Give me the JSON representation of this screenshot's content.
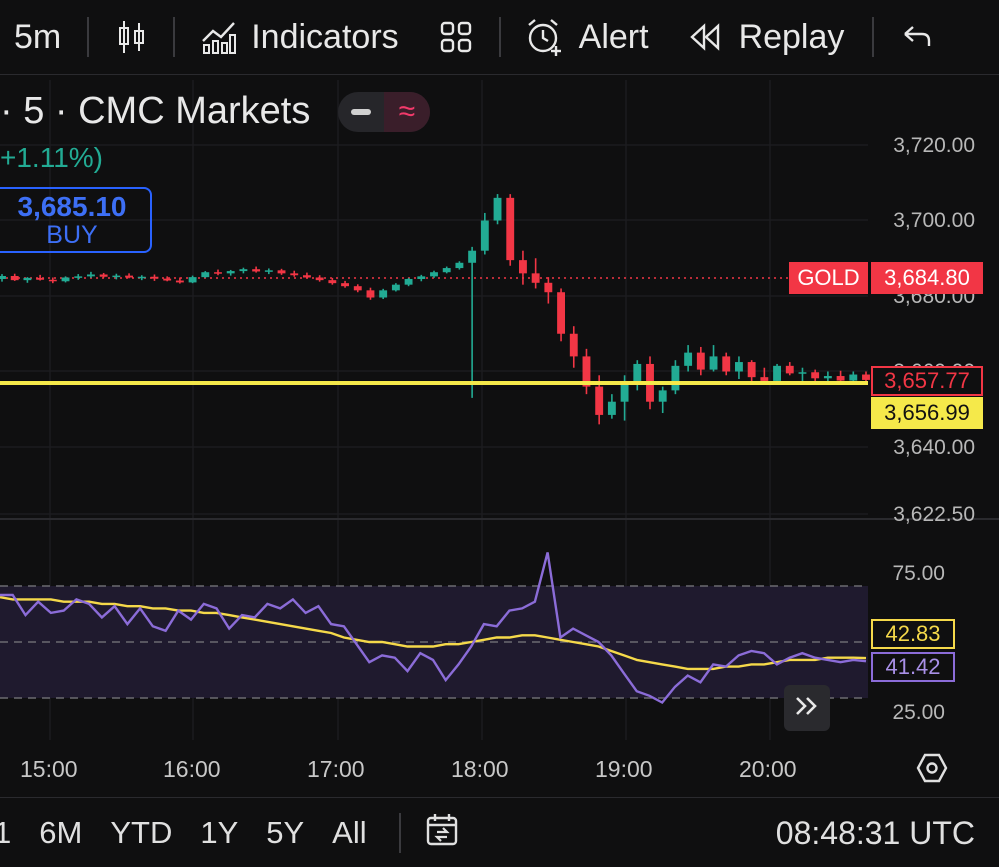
{
  "toolbar": {
    "interval": "5m",
    "indicators_label": "Indicators",
    "alert_label": "Alert",
    "replay_label": "Replay",
    "icons": [
      "candles-icon",
      "indicators-icon",
      "layout-icon",
      "alert-icon",
      "replay-icon",
      "undo-icon"
    ]
  },
  "legend": {
    "title": "· 5 · CMC Markets",
    "change": "+1.11%)",
    "buy_price": "3,685.10",
    "buy_label": "BUY"
  },
  "price_axis": [
    "3,720.00",
    "3,700.00",
    "3,680.00",
    "3,660.00",
    "3,640.00",
    "3,622.50"
  ],
  "tags": {
    "symbol": "GOLD",
    "symbol_price": "3,684.80",
    "last_price": "3,657.77",
    "line_price": "3,656.99",
    "rsi_ma": "42.83",
    "rsi": "41.42"
  },
  "rsi_axis": [
    "75.00",
    "25.00"
  ],
  "time_axis": [
    "15:00",
    "16:00",
    "17:00",
    "18:00",
    "19:00",
    "20:00"
  ],
  "ranges": [
    "1",
    "6M",
    "YTD",
    "1Y",
    "5Y",
    "All"
  ],
  "clock": "08:48:31 UTC",
  "colors": {
    "up": "#22ab94",
    "down": "#f23645",
    "hline": "#f5e94a",
    "rsi": "#8b6cd8",
    "rsi_ma": "#f5d94a"
  },
  "chart_data": {
    "type": "candlestick",
    "interval": "5m",
    "candles_ohlc": [
      [
        3684.5,
        3685.8,
        3683.8,
        3685.3
      ],
      [
        3685.3,
        3685.9,
        3684.0,
        3684.2
      ],
      [
        3684.2,
        3685.0,
        3683.5,
        3684.8
      ],
      [
        3684.8,
        3685.6,
        3684.1,
        3684.3
      ],
      [
        3684.3,
        3684.9,
        3683.4,
        3683.9
      ],
      [
        3683.9,
        3685.2,
        3683.6,
        3684.9
      ],
      [
        3684.9,
        3685.8,
        3684.3,
        3685.2
      ],
      [
        3685.2,
        3686.4,
        3684.8,
        3685.7
      ],
      [
        3685.7,
        3686.1,
        3684.9,
        3685.1
      ],
      [
        3685.1,
        3685.9,
        3684.4,
        3685.4
      ],
      [
        3685.4,
        3686.0,
        3684.7,
        3684.9
      ],
      [
        3684.9,
        3685.5,
        3684.2,
        3685.1
      ],
      [
        3685.1,
        3685.7,
        3684.0,
        3684.6
      ],
      [
        3684.6,
        3685.2,
        3683.9,
        3684.1
      ],
      [
        3684.1,
        3684.9,
        3683.3,
        3683.6
      ],
      [
        3683.6,
        3685.4,
        3683.4,
        3685.0
      ],
      [
        3685.0,
        3686.6,
        3684.8,
        3686.3
      ],
      [
        3686.3,
        3687.0,
        3685.5,
        3686.0
      ],
      [
        3686.0,
        3686.9,
        3685.4,
        3686.6
      ],
      [
        3686.6,
        3687.5,
        3686.0,
        3687.1
      ],
      [
        3687.1,
        3687.8,
        3686.2,
        3686.5
      ],
      [
        3686.5,
        3687.3,
        3685.8,
        3686.8
      ],
      [
        3686.8,
        3687.2,
        3685.6,
        3686.0
      ],
      [
        3686.0,
        3686.7,
        3685.1,
        3685.5
      ],
      [
        3685.5,
        3686.2,
        3684.6,
        3684.9
      ],
      [
        3684.9,
        3685.5,
        3683.8,
        3684.2
      ],
      [
        3684.2,
        3684.8,
        3683.0,
        3683.4
      ],
      [
        3683.4,
        3684.0,
        3682.2,
        3682.6
      ],
      [
        3682.6,
        3683.1,
        3681.0,
        3681.5
      ],
      [
        3681.5,
        3682.2,
        3679.0,
        3679.6
      ],
      [
        3679.6,
        3681.9,
        3679.2,
        3681.5
      ],
      [
        3681.5,
        3683.4,
        3681.2,
        3683.0
      ],
      [
        3683.0,
        3684.8,
        3682.6,
        3684.5
      ],
      [
        3684.5,
        3685.6,
        3683.9,
        3685.2
      ],
      [
        3685.2,
        3686.7,
        3684.8,
        3686.3
      ],
      [
        3686.3,
        3687.8,
        3686.0,
        3687.4
      ],
      [
        3687.4,
        3689.2,
        3687.0,
        3688.8
      ],
      [
        3688.8,
        3693.0,
        3653.0,
        3692.0
      ],
      [
        3692.0,
        3702.0,
        3691.0,
        3700.0
      ],
      [
        3700.0,
        3707.0,
        3699.0,
        3706.0
      ],
      [
        3706.0,
        3707.0,
        3688.0,
        3689.5
      ],
      [
        3689.5,
        3692.0,
        3683.0,
        3686.0
      ],
      [
        3686.0,
        3690.0,
        3682.0,
        3683.5
      ],
      [
        3683.5,
        3685.0,
        3678.0,
        3681.0
      ],
      [
        3681.0,
        3682.0,
        3668.0,
        3670.0
      ],
      [
        3670.0,
        3672.0,
        3661.0,
        3664.0
      ],
      [
        3664.0,
        3666.0,
        3654.0,
        3656.0
      ],
      [
        3656.0,
        3659.0,
        3646.0,
        3648.5
      ],
      [
        3648.5,
        3654.0,
        3647.5,
        3652.0
      ],
      [
        3652.0,
        3659.0,
        3647.0,
        3657.0
      ],
      [
        3657.0,
        3663.0,
        3655.0,
        3662.0
      ],
      [
        3662.0,
        3664.0,
        3650.0,
        3652.0
      ],
      [
        3652.0,
        3656.0,
        3649.0,
        3655.0
      ],
      [
        3655.0,
        3663.0,
        3654.0,
        3661.5
      ],
      [
        3661.5,
        3667.0,
        3660.0,
        3665.0
      ],
      [
        3665.0,
        3666.5,
        3659.0,
        3660.5
      ],
      [
        3660.5,
        3667.0,
        3660.0,
        3664.0
      ],
      [
        3664.0,
        3665.0,
        3659.0,
        3660.0
      ],
      [
        3660.0,
        3664.0,
        3658.0,
        3662.5
      ],
      [
        3662.5,
        3663.0,
        3657.0,
        3658.5
      ],
      [
        3658.5,
        3661.0,
        3656.5,
        3657.5
      ],
      [
        3657.5,
        3662.0,
        3657.0,
        3661.5
      ],
      [
        3661.5,
        3662.5,
        3659.0,
        3659.5
      ],
      [
        3659.5,
        3661.0,
        3657.0,
        3659.8
      ],
      [
        3659.8,
        3660.5,
        3657.5,
        3658.2
      ],
      [
        3658.2,
        3660.0,
        3657.0,
        3658.8
      ],
      [
        3658.8,
        3660.2,
        3657.0,
        3657.6
      ],
      [
        3657.6,
        3660.0,
        3657.0,
        3659.2
      ],
      [
        3659.2,
        3660.0,
        3657.0,
        3657.77
      ]
    ],
    "horizontal_line": 3656.99,
    "rsi_series": [
      71,
      71,
      62,
      68,
      63,
      64,
      69,
      67,
      61,
      66,
      58,
      65,
      57,
      55,
      64,
      60,
      67,
      65,
      56,
      62,
      61,
      67,
      65,
      69,
      63,
      66,
      58,
      57,
      49,
      41,
      44,
      43,
      37,
      45,
      42,
      33,
      40,
      48,
      58,
      57,
      64,
      65,
      68,
      90,
      52,
      56,
      53,
      50,
      44,
      36,
      28,
      26,
      23,
      30,
      35,
      32,
      40,
      39,
      44,
      46,
      45,
      40,
      43,
      45,
      43,
      42,
      41,
      42,
      41.42
    ],
    "rsi_ma_series": [
      70,
      69,
      69,
      69,
      69,
      68,
      68,
      68,
      67,
      67,
      66,
      66,
      65,
      65,
      64,
      64,
      63,
      63,
      62,
      61,
      60,
      59,
      58,
      57,
      56,
      55,
      54,
      52,
      51,
      50,
      50,
      49,
      48,
      48,
      48,
      49,
      49,
      50,
      51,
      52,
      52,
      53,
      53,
      52,
      51,
      50,
      49,
      48,
      46,
      44,
      42,
      41,
      40,
      39,
      38,
      38,
      38,
      39,
      39,
      40,
      40,
      41,
      42,
      42,
      42,
      43,
      43,
      43,
      42.83
    ],
    "price_range": [
      3618,
      3730
    ],
    "rsi_range": [
      0,
      100
    ]
  }
}
